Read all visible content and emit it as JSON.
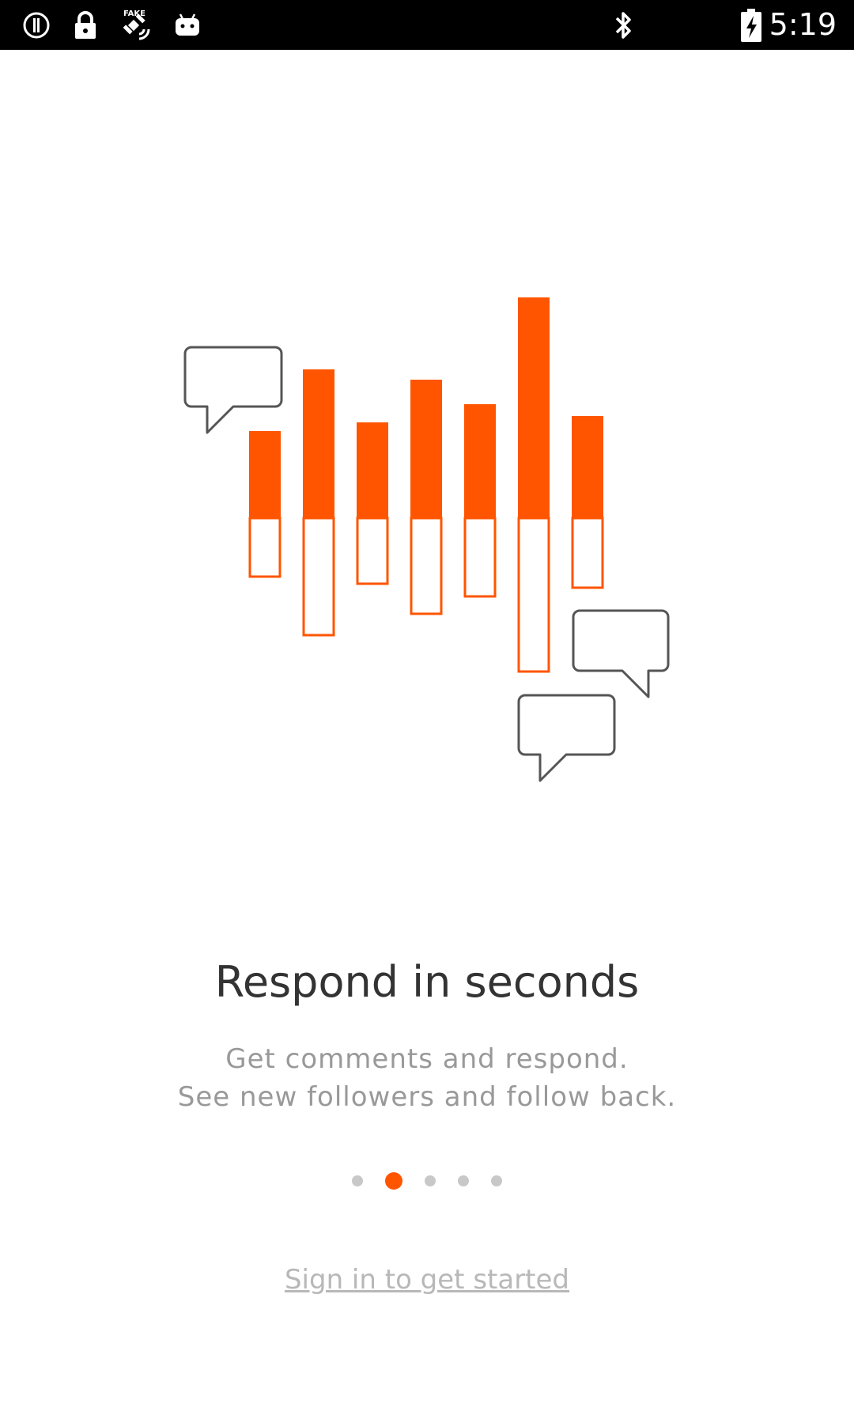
{
  "status_bar": {
    "time": "5:19",
    "left_icons": [
      "info-icon",
      "lock-icon",
      "fake-gps-icon",
      "android-icon"
    ],
    "right_icons": [
      "bluetooth-icon",
      "battery-charging-icon"
    ]
  },
  "onboarding": {
    "title": "Respond in seconds",
    "description_line1": "Get comments and respond.",
    "description_line2": "See new followers and follow back.",
    "page_count": 5,
    "active_page": 2,
    "signin_link": "Sign in to get started"
  },
  "colors": {
    "accent": "#ff5500",
    "status_bar": "#000000",
    "title_text": "#333333",
    "body_text": "#999999",
    "link_text": "#b8b8b8",
    "dot_inactive": "#c8c8c8"
  }
}
